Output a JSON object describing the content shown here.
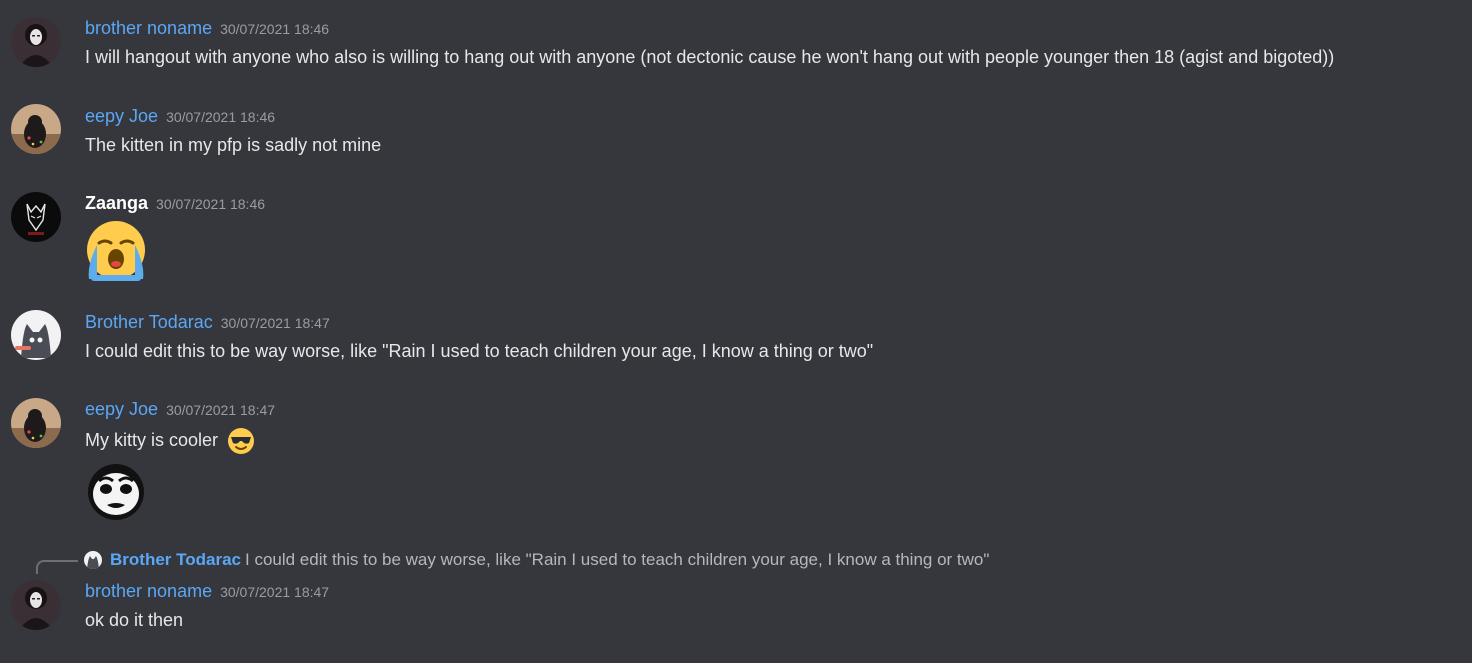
{
  "messages": [
    {
      "author": "brother noname",
      "timestamp": "30/07/2021 18:46",
      "text": "I will hangout with anyone who also is willing to hang out with anyone (not dectonic cause he won't hang out with people younger then 18 (agist and bigoted))"
    },
    {
      "author": "eepy Joe",
      "timestamp": "30/07/2021 18:46",
      "text": "The kitten in my pfp is sadly not mine"
    },
    {
      "author": "Zaanga",
      "timestamp": "30/07/2021 18:46",
      "emoji": "loudly-crying-face"
    },
    {
      "author": "Brother Todarac",
      "timestamp": "30/07/2021 18:47",
      "text": "I could edit this to be way worse, like \"Rain I used to teach children your age, I know a thing or two\""
    },
    {
      "author": "eepy Joe",
      "timestamp": "30/07/2021 18:47",
      "text": "My kitty is cooler",
      "emoji": "smiling-face-with-sunglasses",
      "sticker": "me-gusta-face"
    },
    {
      "reply_to": {
        "author": "Brother Todarac",
        "text": "I could edit this to be way worse, like \"Rain I used to teach children your age, I know a thing or two\""
      },
      "author": "brother noname",
      "timestamp": "30/07/2021 18:47",
      "text": "ok do it then"
    }
  ],
  "colors": {
    "background": "#36373d",
    "username_blue": "#5aa7f5",
    "username_white": "#ffffff",
    "timestamp": "#9a9ca3",
    "message_text": "#e6e7e9"
  }
}
